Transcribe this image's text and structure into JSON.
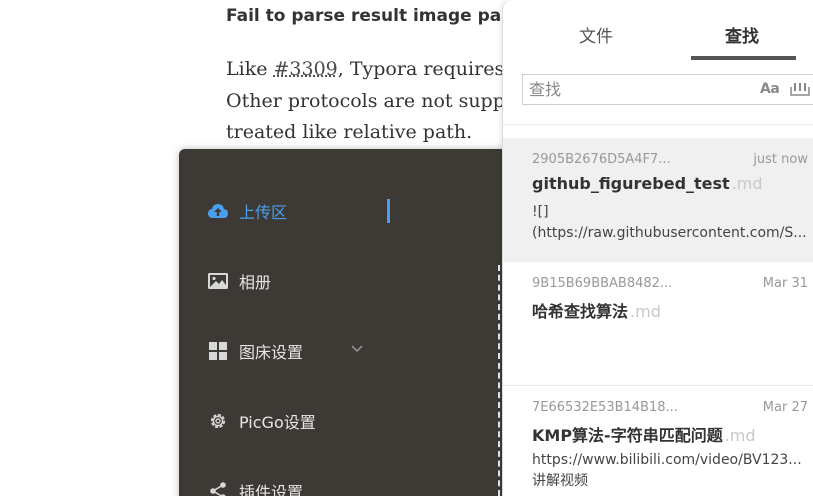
{
  "document": {
    "heading": "Fail to parse result image pa",
    "line1_prefix": "Like ",
    "line1_link": "#3309",
    "line1_suffix": ", Typora requires",
    "line2": "Other protocols are not supp",
    "line3": "treated like relative path."
  },
  "picgo": {
    "nav": [
      {
        "label": "上传区",
        "icon": "cloud-upload-icon",
        "active": true
      },
      {
        "label": "相册",
        "icon": "image-icon"
      },
      {
        "label": "图床设置",
        "icon": "grid-icon",
        "expandable": true
      },
      {
        "label": "PicGo设置",
        "icon": "gear-icon"
      },
      {
        "label": "插件设置",
        "icon": "share-icon"
      }
    ],
    "accent_color": "#4a9eef",
    "background_color": "#3d3934"
  },
  "panel": {
    "tabs": [
      {
        "label": "文件"
      },
      {
        "label": "查找",
        "active": true
      }
    ],
    "search": {
      "placeholder": "查找",
      "value": "",
      "case_toggle_label": "Aa"
    },
    "results": [
      {
        "id": "2905B2676D5A4F7...",
        "date": "just now",
        "title": "github_figurebed_test",
        "ext": ".md",
        "snippet_lines": [
          "![]",
          "(https://raw.githubusercontent.com/S..."
        ],
        "selected": true
      },
      {
        "id": "9B15B69BBAB8482...",
        "date": "Mar 31",
        "title": "哈希查找算法",
        "ext": ".md",
        "snippet_lines": []
      },
      {
        "id": "7E66532E53B14B18...",
        "date": "Mar 27",
        "title": "KMP算法-字符串匹配问题",
        "ext": ".md",
        "snippet_lines": [
          "https://www.bilibili.com/video/BV123...",
          "讲解视频"
        ]
      }
    ]
  }
}
